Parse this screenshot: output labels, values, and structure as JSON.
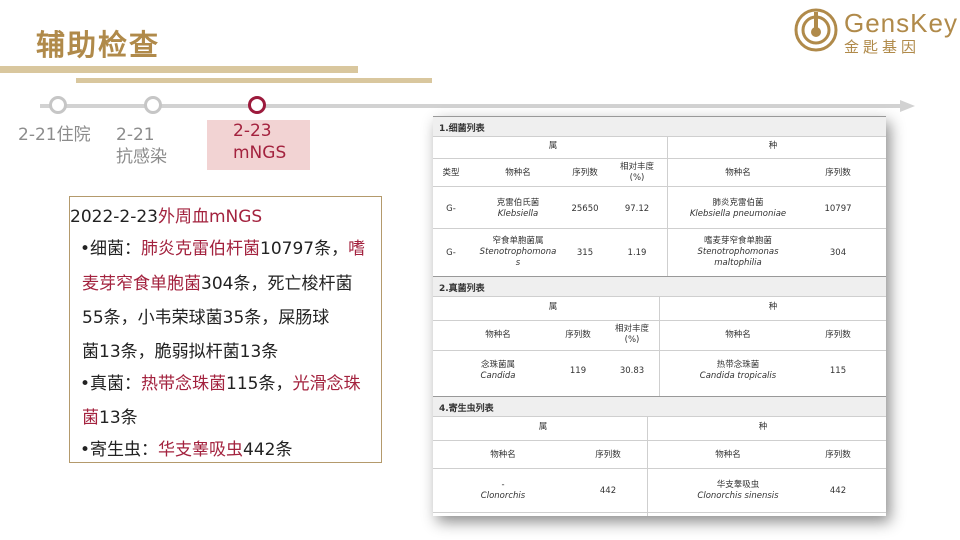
{
  "slide": {
    "title": "辅助检查"
  },
  "logo": {
    "en": "GensKey",
    "cn": "金匙基因",
    "color": "#b08a4a"
  },
  "timeline": {
    "items": [
      {
        "label_line1": "2-21住院",
        "label_line2": ""
      },
      {
        "label_line1": "2-21",
        "label_line2": "抗感染"
      },
      {
        "label_line1": "2-23",
        "label_line2": "mNGS"
      }
    ]
  },
  "textbox": {
    "heading": {
      "date": "2022-2-23",
      "title": "外周血mNGS"
    },
    "bacteria": {
      "label": "•细菌：",
      "l1_hl1": "肺炎克雷伯杆菌",
      "l1_t": "10797条，",
      "l1_hl2": "嗜",
      "l2_hl": "麦芽窄食单胞菌",
      "l2_t": "304条，死亡梭杆菌",
      "l3_t": "55条，小韦荣球菌35条，屎肠球",
      "l4_t": "菌13条，脆弱拟杆菌13条"
    },
    "fungi": {
      "label": "•真菌：",
      "hl1": "热带念珠菌",
      "t1": "115条，",
      "hl2": "光滑念珠",
      "hl3": "菌",
      "t2": "13条"
    },
    "parasite": {
      "label": "•寄生虫：",
      "hl": "华支睾吸虫",
      "t": "442条"
    }
  },
  "report": {
    "bacteria_table": {
      "title": "1.细菌列表",
      "genus": "属",
      "species": "种",
      "headers": [
        "类型",
        "物种名",
        "序列数",
        "相对丰度(%)",
        "物种名",
        "序列数"
      ],
      "rows": [
        {
          "type": "G-",
          "genus_cn": "克雷伯氏菌",
          "genus_latin": "Klebsiella",
          "count": "25650",
          "abundance": "97.12",
          "species_cn": "肺炎克雷伯菌",
          "species_latin": "Klebsiella pneumoniae",
          "species_count": "10797"
        },
        {
          "type": "G-",
          "genus_cn": "窄食单胞菌属",
          "genus_latin": "Stenotrophomonas",
          "count": "315",
          "abundance": "1.19",
          "species_cn": "嗜麦芽窄食单胞菌",
          "species_latin": "Stenotrophomonas maltophilia",
          "species_count": "304"
        }
      ]
    },
    "fungi_table": {
      "title": "2.真菌列表",
      "genus": "属",
      "species": "种",
      "headers": [
        "物种名",
        "序列数",
        "相对丰度(%)",
        "物种名",
        "序列数"
      ],
      "rows": [
        {
          "genus_cn": "念珠菌属",
          "genus_latin": "Candida",
          "count": "119",
          "abundance": "30.83",
          "species_cn": "热带念珠菌",
          "species_latin": "Candida tropicalis",
          "species_count": "115"
        }
      ]
    },
    "parasite_table": {
      "title": "4.寄生虫列表",
      "genus": "属",
      "species": "种",
      "headers": [
        "物种名",
        "序列数",
        "物种名",
        "序列数"
      ],
      "rows": [
        {
          "genus_cn": "-",
          "genus_latin": "Clonorchis",
          "count": "442",
          "species_cn": "华支睾吸虫",
          "species_latin": "Clonorchis sinensis",
          "species_count": "442"
        }
      ]
    }
  }
}
